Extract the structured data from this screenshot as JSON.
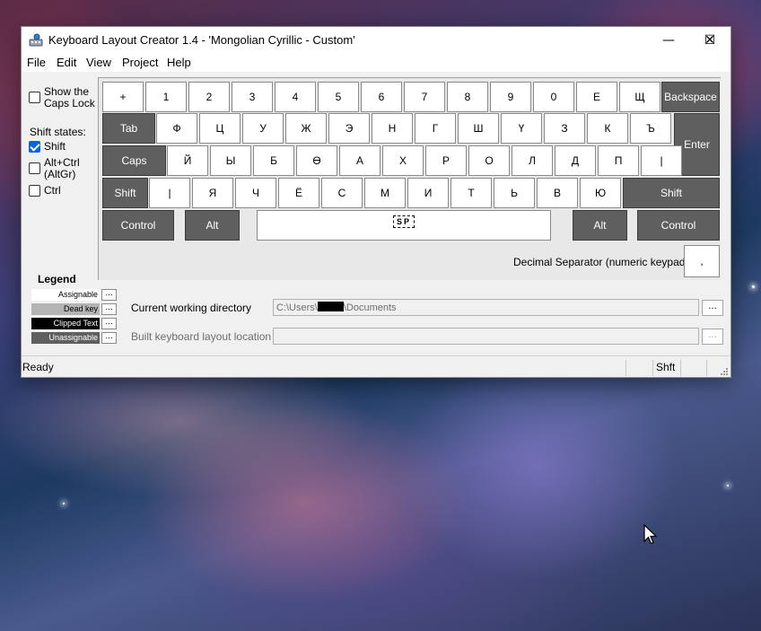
{
  "window": {
    "title": "Keyboard Layout Creator 1.4 - 'Mongolian Cyrillic - Custom'",
    "minimize_glyph": "—",
    "maximize_glyph": "☐",
    "close_glyph": "✕"
  },
  "menu": [
    "File",
    "Edit",
    "View",
    "Project",
    "Help"
  ],
  "left_panel": {
    "show_caps_lock": {
      "label_line1": "Show the",
      "label_line2": "Caps Lock",
      "checked": false
    },
    "shift_states_label": "Shift states:",
    "shift": {
      "label": "Shift",
      "checked": true
    },
    "altgr": {
      "label_line1": "Alt+Ctrl",
      "label_line2": "(AltGr)",
      "checked": false
    },
    "ctrl": {
      "label": "Ctrl",
      "checked": false
    }
  },
  "keyboard": {
    "row1": [
      "+",
      "1",
      "2",
      "3",
      "4",
      "5",
      "6",
      "7",
      "8",
      "9",
      "0",
      "Е",
      "Щ"
    ],
    "backspace": "Backspace",
    "tab": "Tab",
    "row2": [
      "Ф",
      "Ц",
      "У",
      "Ж",
      "Э",
      "Н",
      "Г",
      "Ш",
      "Ү",
      "З",
      "К",
      "Ъ"
    ],
    "enter": "Enter",
    "caps": "Caps",
    "row3": [
      "Й",
      "Ы",
      "Б",
      "Ө",
      "А",
      "Х",
      "Р",
      "О",
      "Л",
      "Д",
      "П",
      "|"
    ],
    "shift_left": "Shift",
    "row4": [
      "|",
      "Я",
      "Ч",
      "Ё",
      "С",
      "М",
      "И",
      "Т",
      "Ь",
      "В",
      "Ю"
    ],
    "shift_right": "Shift",
    "control_left": "Control",
    "alt_left": "Alt",
    "space": "SP",
    "alt_right": "Alt",
    "control_right": "Control",
    "decimal_separator_label": "Decimal Separator (numeric keypad)",
    "decimal_separator_key": ","
  },
  "legend": {
    "title": "Legend",
    "items": [
      {
        "label": "Assignable",
        "bg": "#ffffff",
        "fg": "#000000"
      },
      {
        "label": "Dead key",
        "bg": "#b4b4b4",
        "fg": "#000000"
      },
      {
        "label": "Clipped Text",
        "bg": "#000000",
        "fg": "#ffffff"
      },
      {
        "label": "Unassignable",
        "bg": "#5f5f5f",
        "fg": "#ffffff"
      }
    ],
    "button_label": "..."
  },
  "fields": {
    "cwd_label": "Current working directory",
    "cwd_prefix": "C:\\Users\\",
    "cwd_suffix": "\\Documents",
    "cwd_button": "...",
    "build_label": "Built keyboard layout location",
    "build_value": "",
    "build_button": "..."
  },
  "status": {
    "text": "Ready",
    "shift_indicator": "Shft"
  },
  "colors": {
    "fn_key": "#5f5f5f",
    "checkbox_accent": "#0a64d8"
  }
}
